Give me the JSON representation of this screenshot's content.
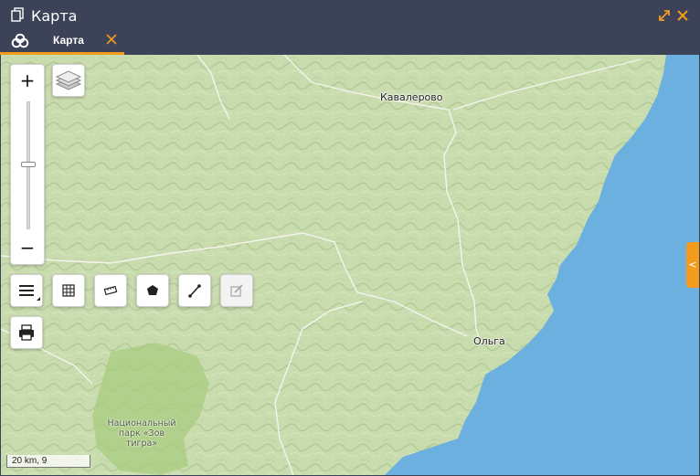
{
  "window": {
    "title": "Карта"
  },
  "tabs": [
    {
      "label": "Карта",
      "active": true
    }
  ],
  "map": {
    "cities": [
      {
        "name": "Кавалерово"
      },
      {
        "name": "Ольга"
      }
    ],
    "park_label": [
      "Национальный",
      "парк «Зов",
      "тигра»"
    ],
    "scale_label": "20 km, 9",
    "zoom_level_fraction": 0.5,
    "colors": {
      "land": "#c9dcae",
      "sea": "#6cb0e0",
      "park": "#a8cc7f",
      "accent": "#f29b1d",
      "header": "#3c4257"
    }
  },
  "controls": {
    "zoom_in": "+",
    "zoom_out": "−",
    "side_toggle": "<",
    "icons": [
      "layers-icon",
      "menu-icon",
      "grid-icon",
      "ruler-icon",
      "polygon-icon",
      "line-icon",
      "edit-icon",
      "print-icon"
    ]
  }
}
